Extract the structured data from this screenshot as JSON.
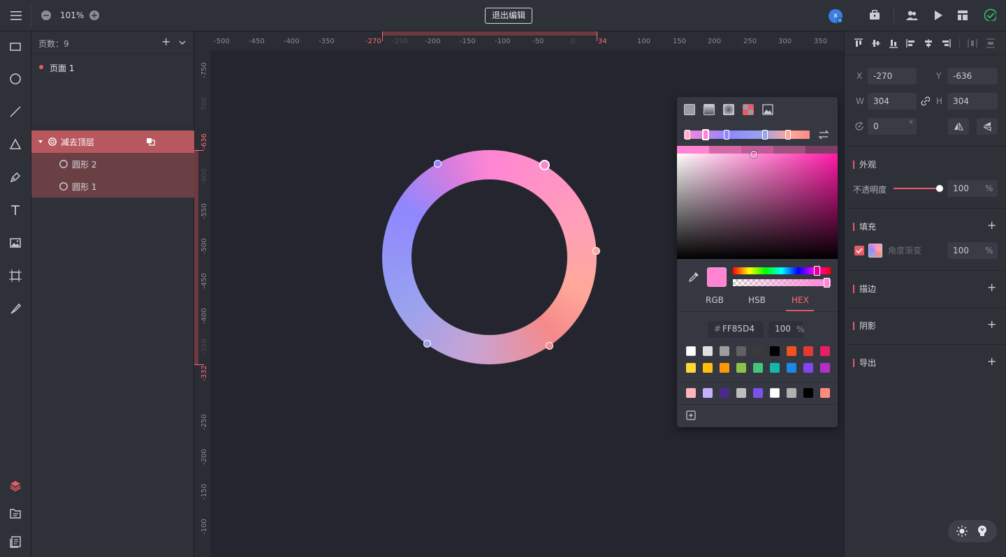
{
  "topbar": {
    "zoom": "101%",
    "exit_label": "退出编辑",
    "avatar_letter": "x"
  },
  "layers": {
    "page_count_label": "页数：9",
    "pages": [
      {
        "label": "页面 1"
      }
    ],
    "items": [
      {
        "label": "减去顶层",
        "level": 0
      },
      {
        "label": "圆形 2",
        "level": 1
      },
      {
        "label": "圆形 1",
        "level": 1
      }
    ]
  },
  "ruler": {
    "top_ticks": [
      "-500",
      "-450",
      "-400",
      "-350",
      "-270",
      "-250",
      "-200",
      "-150",
      "-100",
      "-50",
      "0",
      "34",
      "100",
      "150",
      "200",
      "250",
      "300",
      "350"
    ],
    "left_ticks": [
      "-750",
      "-700",
      "-636",
      "-600",
      "-550",
      "-500",
      "-450",
      "-400",
      "-350",
      "-332",
      "-250",
      "-200",
      "-150",
      "-100"
    ]
  },
  "props": {
    "x_label": "X",
    "x": "-270",
    "y_label": "Y",
    "y": "-636",
    "w_label": "W",
    "w": "304",
    "h_label": "H",
    "h": "304",
    "rotation": "0",
    "rotation_unit": "°",
    "appearance_title": "外观",
    "opacity_label": "不透明度",
    "opacity": "100",
    "percent": "%",
    "fill_title": "填充",
    "fill_type": "角度渐变",
    "fill_opacity": "100",
    "stroke_title": "描边",
    "shadow_title": "阴影",
    "export_title": "导出"
  },
  "picker": {
    "tabs": [
      "RGB",
      "HSB",
      "HEX"
    ],
    "active_tab": "HEX",
    "hex_prefix": "#",
    "hex": "FF85D4",
    "alpha": "100",
    "alpha_unit": "%",
    "swatches_row1": [
      "#ffffff",
      "#e0e0e0",
      "#9e9e9e",
      "#616161",
      "#3a3a3a",
      "#000000",
      "#f4511e",
      "#e53935",
      "#e91e63"
    ],
    "swatches_row2": [
      "#fdd835",
      "#ffc107",
      "#ff9800",
      "#8bc34a",
      "#43c57a",
      "#14b8a6",
      "#1e88e5",
      "#8146f0",
      "#b62fc4"
    ],
    "recent": [
      "#ffb3bd",
      "#c3b0ff",
      "#4a2b8c",
      "#bdbdbd",
      "#7c52e8",
      "#ffffff",
      "#b0b0b0",
      "#000000",
      "#ff8a80"
    ]
  },
  "colors": {
    "accent": "#e65c67",
    "selected_layer": "#b6585d",
    "selected_child": "#6b4045",
    "current_color": "#FF85D4"
  }
}
